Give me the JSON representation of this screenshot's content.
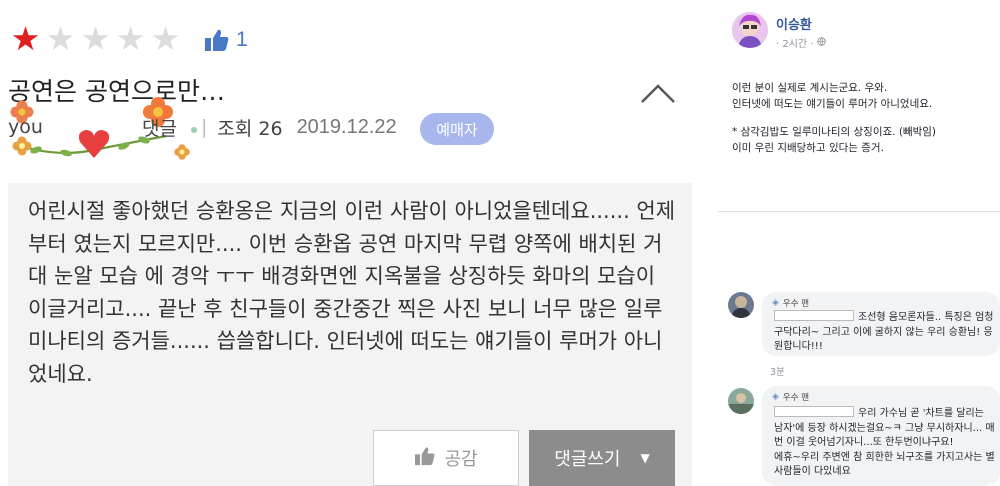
{
  "review": {
    "rating": {
      "filled": 1,
      "total": 5
    },
    "like_count": "1",
    "title": "공연은 공연으로만…",
    "author": "you",
    "comments_label": "댓글",
    "views_label": "조회 26",
    "date": "2019.12.22",
    "badge": "예매자",
    "body": "어린시절 좋아했던 승환옹은 지금의 이런 사람이 아니었을텐데요...... 언제부터 였는지 모르지만.... 이번 승환옵 공연 마지막 무렵 양쪽에 배치된 거대 눈알 모습 에 경악 ㅜㅜ 배경화면엔 지옥불을 상징하듯 화마의 모습이 이글거리고.... 끝난 후 친구들이 중간중간 찍은 사진 보니 너무 많은 일루미나티의 증거들...... 씁쓸합니다. 인터넷에 떠도는 얘기들이 루머가 아니었네요.",
    "like_button": "공감",
    "comment_button": "댓글쓰기",
    "colors": {
      "star_on": "#e02020",
      "badge": "#a8b6ee",
      "comment_btn": "#8c8c8c"
    }
  },
  "social": {
    "user_name": "이승환",
    "time": "· 2시간 ·",
    "post_lines": [
      "이런 분이 실제로 계시는군요. 우와.\n인터넷에 떠도는 얘기들이 루머가 아니었네요.",
      "* 삼각김밥도 일루미나티의 상징이죠. (빼박임)\n이미 우린 지배당하고 있다는 증거."
    ],
    "comments": [
      {
        "badge": "우수 팬",
        "text": "조선형 음모론자들.. 특징은 엄청 구닥다리~ 그리고 이에 굴하지 않는 우리 승환님! 응원합니다!!!",
        "time": "3분"
      },
      {
        "badge": "우수 팬",
        "text": "우리 가수님 곧 '차트를 달리는 남자'에 등장 하시겠는걸요~ㅋ 그냥 무시하자니... 매번 이걸 웃어넘기자니...또 한두번이냐구요!\n에휴~우리 주변엔 참 희한한 뇌구조를 가지고사는 별 사람들이 다있네요"
      }
    ]
  }
}
